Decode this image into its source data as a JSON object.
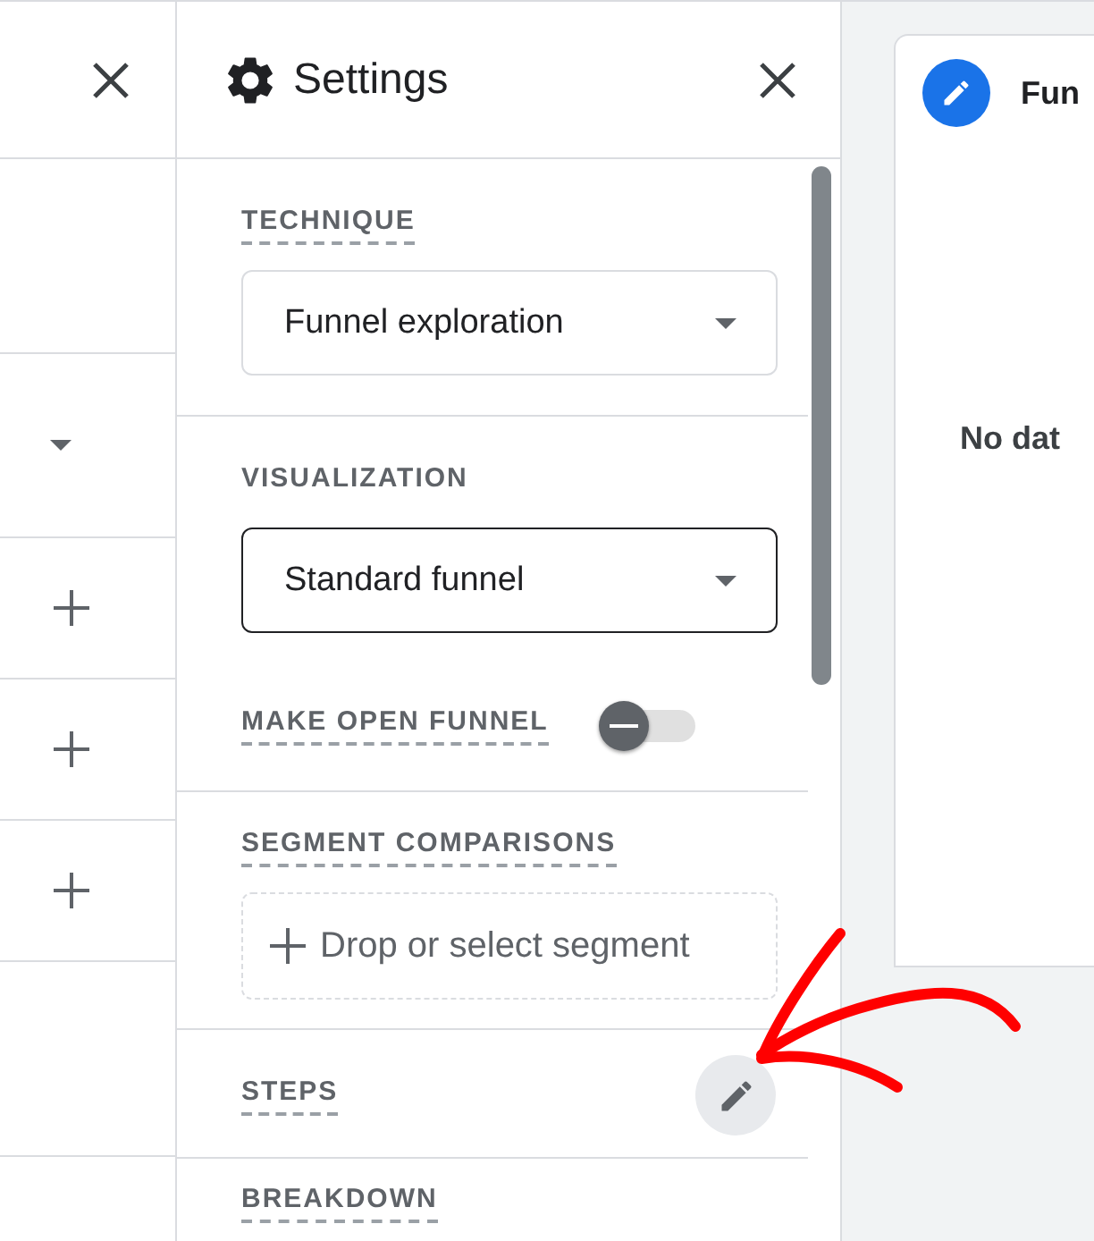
{
  "left_panel": {
    "rows": [
      {
        "kind": "blank"
      },
      {
        "kind": "caret"
      },
      {
        "kind": "plus"
      },
      {
        "kind": "plus"
      },
      {
        "kind": "plus"
      },
      {
        "kind": "blank"
      }
    ]
  },
  "settings": {
    "title": "Settings",
    "technique": {
      "label": "TECHNIQUE",
      "dashed": true,
      "value": "Funnel exploration",
      "focused": false
    },
    "visualization": {
      "label": "VISUALIZATION",
      "dashed": false,
      "value": "Standard funnel",
      "focused": true
    },
    "open_funnel": {
      "label": "MAKE OPEN FUNNEL",
      "dashed": true,
      "on": false
    },
    "segment_comparisons": {
      "label": "SEGMENT COMPARISONS",
      "dashed": true,
      "drop_text": "Drop or select segment"
    },
    "steps": {
      "label": "STEPS",
      "dashed": true
    },
    "breakdown": {
      "label": "BREAKDOWN",
      "dashed": true
    }
  },
  "canvas": {
    "tab_title": "Fun",
    "message": "No dat"
  }
}
